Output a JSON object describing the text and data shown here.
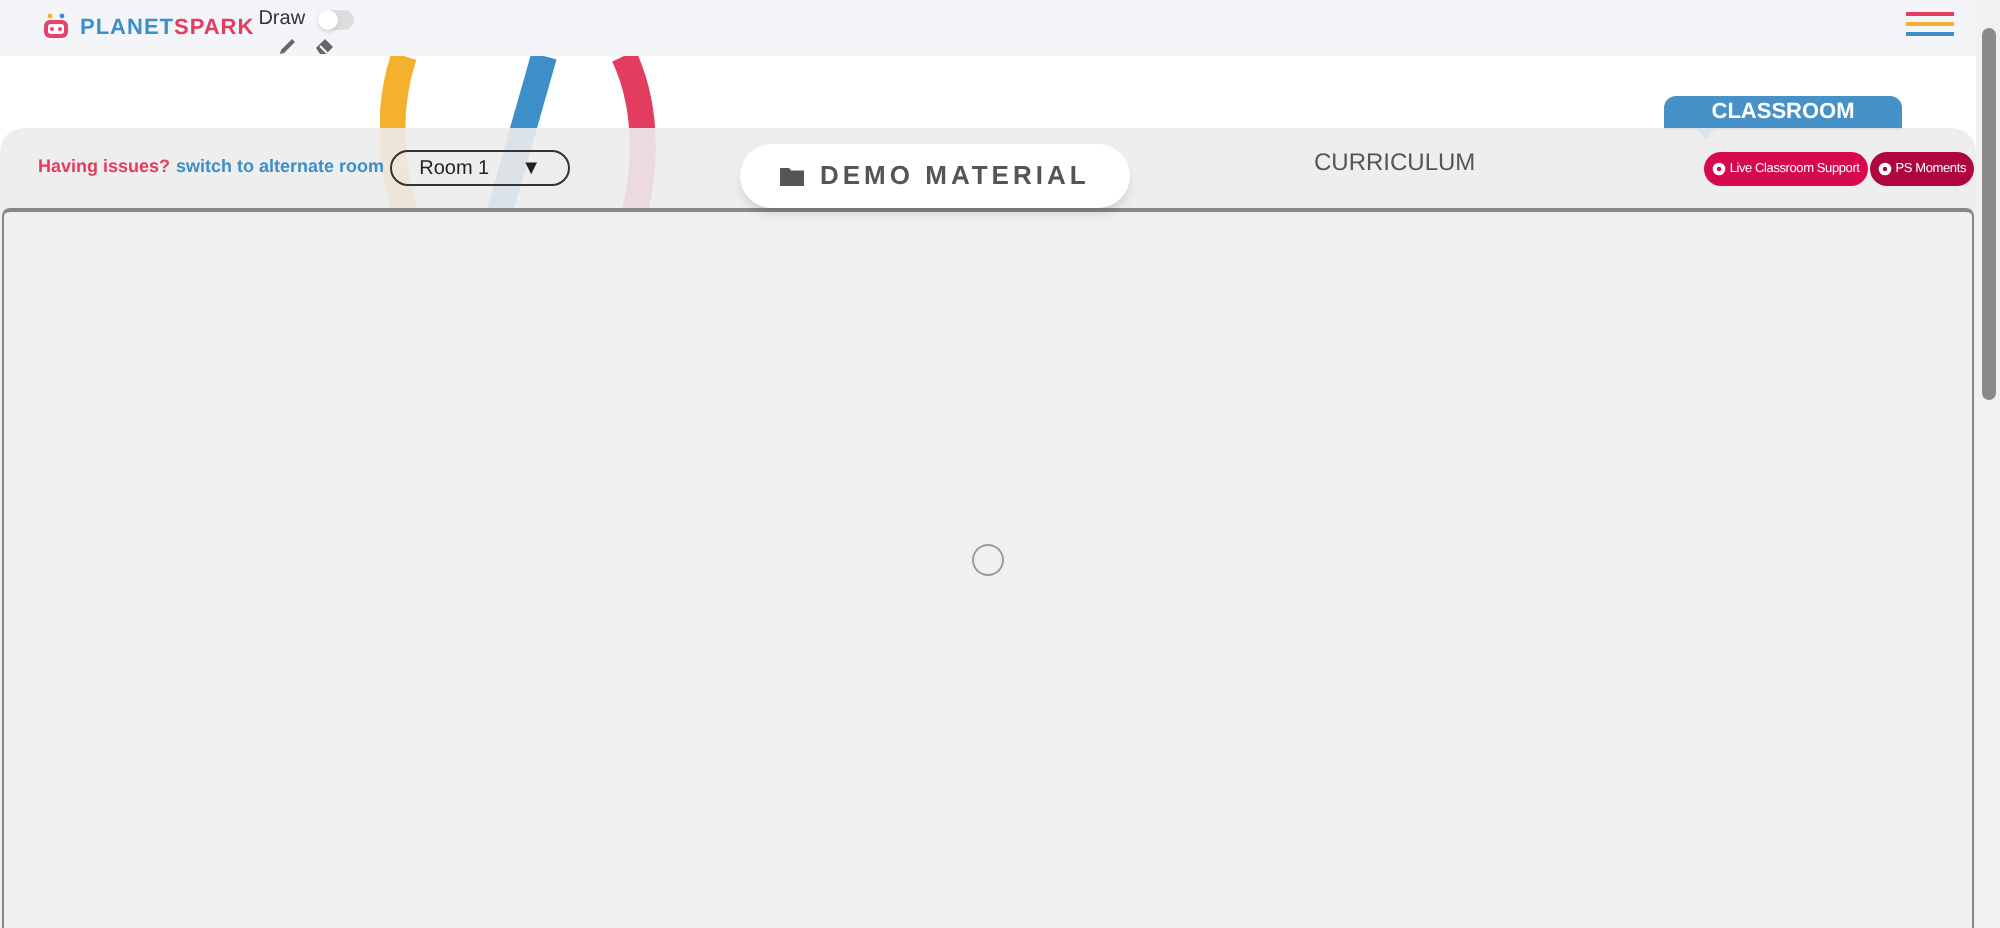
{
  "header": {
    "logo": {
      "part_1": "PLANET",
      "part_2": "SPARK"
    },
    "draw_label": "Draw",
    "draw_on": false
  },
  "classroom_tag": "CLASSROOM",
  "toolbar": {
    "issue_text": "Having issues?",
    "switch_link": "switch to alternate room",
    "room_select": "Room 1",
    "room_caret": "▼",
    "tabs": [
      {
        "label": "DEMO MATERIAL",
        "selected": true
      },
      {
        "label": "CURRICULUM",
        "selected": false
      }
    ],
    "buttons": [
      {
        "label": "Live Classroom Support",
        "color": "#d6084f"
      },
      {
        "label": "PS Moments",
        "color": "#b0063f"
      }
    ]
  }
}
